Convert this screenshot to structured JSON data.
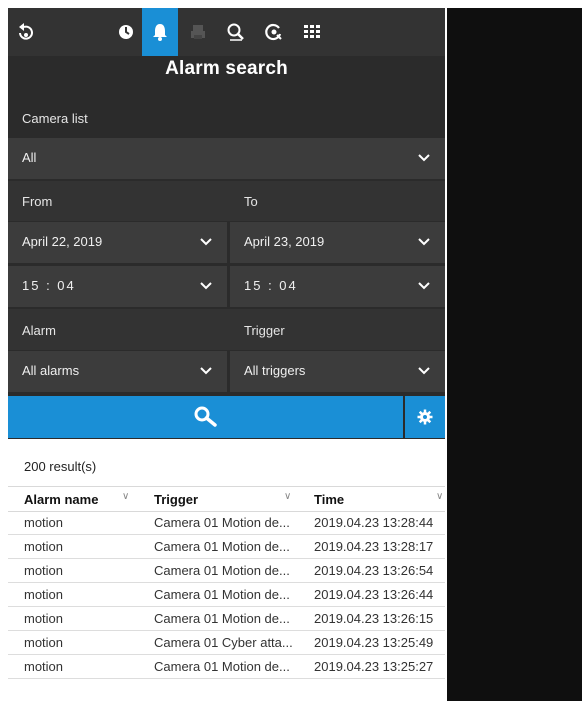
{
  "toolbar": {
    "icons": [
      "playback-icon",
      "clock-icon",
      "alarm-bell-icon",
      "printer-icon",
      "search-zoom-icon",
      "camera-search-icon",
      "grid-icon"
    ],
    "active": "alarm-bell-icon",
    "accent_color": "#1a8fd6"
  },
  "title": "Alarm search",
  "camera_list": {
    "label": "Camera list",
    "value": "All"
  },
  "from": {
    "label": "From",
    "date": "April 22, 2019",
    "time": "15 : 04"
  },
  "to": {
    "label": "To",
    "date": "April 23, 2019",
    "time": "15 : 04"
  },
  "alarm": {
    "label": "Alarm",
    "value": "All alarms"
  },
  "trigger": {
    "label": "Trigger",
    "value": "All triggers"
  },
  "results": {
    "count_text": "200 result(s)",
    "columns": [
      "Alarm name",
      "Trigger",
      "Time"
    ],
    "rows": [
      [
        "motion",
        "Camera 01 Motion de...",
        "2019.04.23 13:28:44"
      ],
      [
        "motion",
        "Camera 01 Motion de...",
        "2019.04.23 13:28:17"
      ],
      [
        "motion",
        "Camera 01 Motion de...",
        "2019.04.23 13:26:54"
      ],
      [
        "motion",
        "Camera 01 Motion de...",
        "2019.04.23 13:26:44"
      ],
      [
        "motion",
        "Camera 01 Motion de...",
        "2019.04.23 13:26:15"
      ],
      [
        "motion",
        "Camera 01 Cyber atta...",
        "2019.04.23 13:25:49"
      ],
      [
        "motion",
        "Camera 01 Motion de...",
        "2019.04.23 13:25:27"
      ]
    ]
  }
}
